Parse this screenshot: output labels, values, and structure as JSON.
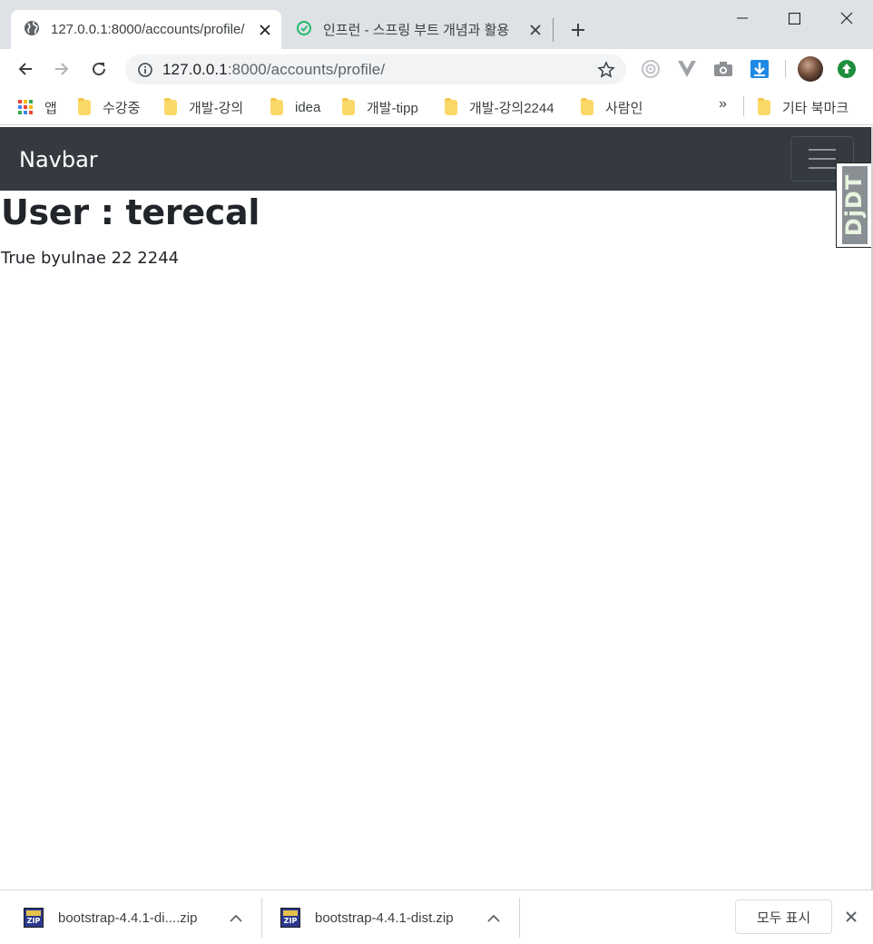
{
  "browser": {
    "tabs": [
      {
        "title": "127.0.0.1:8000/accounts/profile/",
        "icon": "globe-icon",
        "active": true
      },
      {
        "title": "인프런 - 스프링 부트 개념과 활용",
        "icon": "inflearn-icon",
        "active": false
      }
    ],
    "address": {
      "host": "127.0.0.1",
      "rest": ":8000/accounts/profile/"
    },
    "bookmarks": [
      {
        "label": "앱",
        "icon": "apps-icon"
      },
      {
        "label": "수강중",
        "icon": "folder-icon"
      },
      {
        "label": "개발-강의",
        "icon": "folder-icon"
      },
      {
        "label": "idea",
        "icon": "folder-icon"
      },
      {
        "label": "개발-tipp",
        "icon": "folder-icon"
      },
      {
        "label": "개발-강의2244",
        "icon": "folder-icon"
      },
      {
        "label": "사람인",
        "icon": "folder-icon"
      }
    ],
    "bookmarks_overflow": "»",
    "other_bookmarks": "기타 북마크"
  },
  "page": {
    "navbar_brand": "Navbar",
    "title": "User : terecal",
    "profile_line": "True byulnae 22 2244",
    "djdt_label": "DjDT"
  },
  "downloads": {
    "items": [
      {
        "name": "bootstrap-4.4.1-di....zip",
        "icon": "zip-icon"
      },
      {
        "name": "bootstrap-4.4.1-dist.zip",
        "icon": "zip-icon"
      }
    ],
    "show_all": "모두 표시"
  },
  "colors": {
    "navbar_bg": "#343a40",
    "tabstrip_bg": "#dee1e6",
    "omnibox_bg": "#f1f3f4"
  }
}
